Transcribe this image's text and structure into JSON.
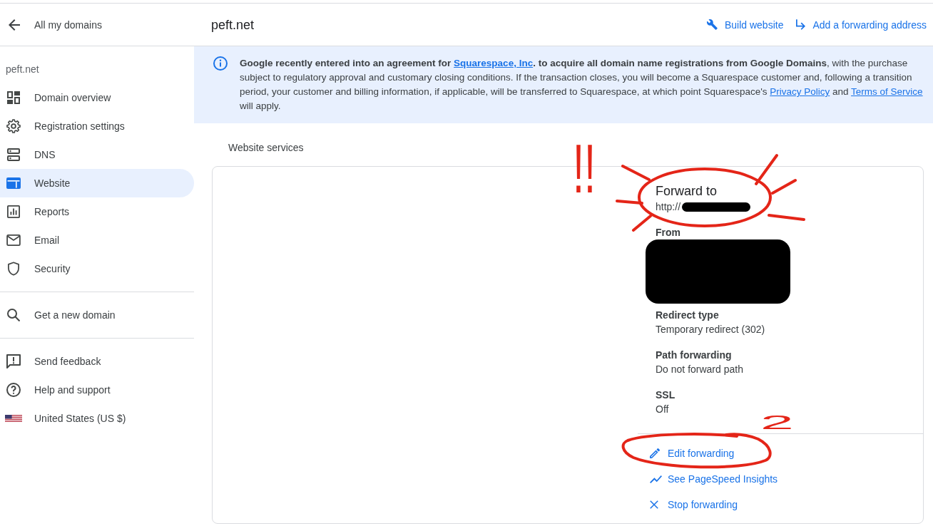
{
  "header": {
    "back_link": "All my domains",
    "title": "peft.net",
    "actions": [
      {
        "label": "Build website"
      },
      {
        "label": "Add a forwarding address"
      }
    ]
  },
  "sidebar": {
    "domain": "peft.net",
    "sections": [
      {
        "items": [
          {
            "label": "Domain overview",
            "selected": false
          },
          {
            "label": "Registration settings",
            "selected": false
          },
          {
            "label": "DNS",
            "selected": false
          },
          {
            "label": "Website",
            "selected": true
          },
          {
            "label": "Reports",
            "selected": false
          },
          {
            "label": "Email",
            "selected": false
          },
          {
            "label": "Security",
            "selected": false
          }
        ]
      },
      {
        "items": [
          {
            "label": "Get a new domain",
            "selected": false
          }
        ]
      },
      {
        "items": [
          {
            "label": "Send feedback",
            "selected": false
          },
          {
            "label": "Help and support",
            "selected": false
          },
          {
            "label": "United States (US $)",
            "selected": false
          }
        ]
      }
    ]
  },
  "notice": {
    "segments": [
      {
        "kind": "text",
        "text": "**Google recently entered into an agreement for** "
      },
      {
        "kind": "link",
        "text": "Squarespace, Inc",
        "bold": true
      },
      {
        "kind": "text",
        "text": "**. to acquire all domain name registrations from Google Domains**, with the purchase subject to regulatory approval and customary closing conditions. If the transaction closes, you will become a Squarespace customer and, following a transition period, your customer and billing information, if applicable, will be transferred to Squarespace, at which point Squarespace's "
      },
      {
        "kind": "link",
        "text": "Privacy Policy",
        "bold": false
      },
      {
        "kind": "text",
        "text": " and "
      },
      {
        "kind": "link",
        "text": "Terms of Service",
        "bold": false
      },
      {
        "kind": "text",
        "text": " will apply."
      }
    ]
  },
  "website_services": {
    "title": "Website services",
    "forward_to": {
      "label": "Forward to",
      "value": "http://",
      "redacted": true
    },
    "details": [
      {
        "label": "From",
        "redacted": true
      },
      {
        "label": "Redirect type",
        "value": "Temporary redirect (302)",
        "redacted": false
      },
      {
        "label": "Path forwarding",
        "value": "Do not forward path",
        "redacted": false
      },
      {
        "label": "SSL",
        "value": "Off",
        "redacted": false
      }
    ],
    "actions": [
      {
        "label": "Edit forwarding"
      },
      {
        "label": "See PageSpeed Insights"
      },
      {
        "label": "Stop forwarding"
      }
    ]
  },
  "annotations": [
    {
      "kind": "burst"
    },
    {
      "kind": "note",
      "text": "!!"
    },
    {
      "kind": "note",
      "text": "2"
    },
    {
      "kind": "oval"
    }
  ]
}
